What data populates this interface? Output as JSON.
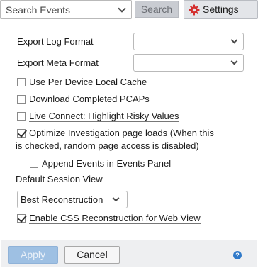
{
  "toolbar": {
    "search_value": "Search Events",
    "search_button": "Search",
    "settings_button": "Settings"
  },
  "settings": {
    "export_log_format_label": "Export Log Format",
    "export_log_format_value": "",
    "export_meta_format_label": "Export Meta Format",
    "export_meta_format_value": "",
    "options": [
      {
        "label": "Use Per Device Local Cache",
        "checked": false
      },
      {
        "label": "Download Completed PCAPs",
        "checked": false
      },
      {
        "label": "Live Connect: Highlight Risky Values",
        "checked": false
      },
      {
        "label_line1": "Optimize Investigation page loads (When this",
        "label_line2": "is checked, random page access is disabled)",
        "checked": true
      },
      {
        "label": "Append Events in Events Panel",
        "checked": false
      }
    ],
    "default_session_view_label": "Default Session View",
    "default_session_view_value": "Best Reconstruction",
    "css_reconstruction": {
      "label": "Enable CSS Reconstruction for Web View",
      "checked": true
    }
  },
  "footer": {
    "apply_label": "Apply",
    "cancel_label": "Cancel",
    "help_glyph": "?"
  },
  "icons": {
    "settings": "gear-icon",
    "help": "help-icon"
  },
  "colors": {
    "gear": "#d42e2e",
    "apply_bg": "#9ec0e3",
    "help": "#2f79c9"
  }
}
